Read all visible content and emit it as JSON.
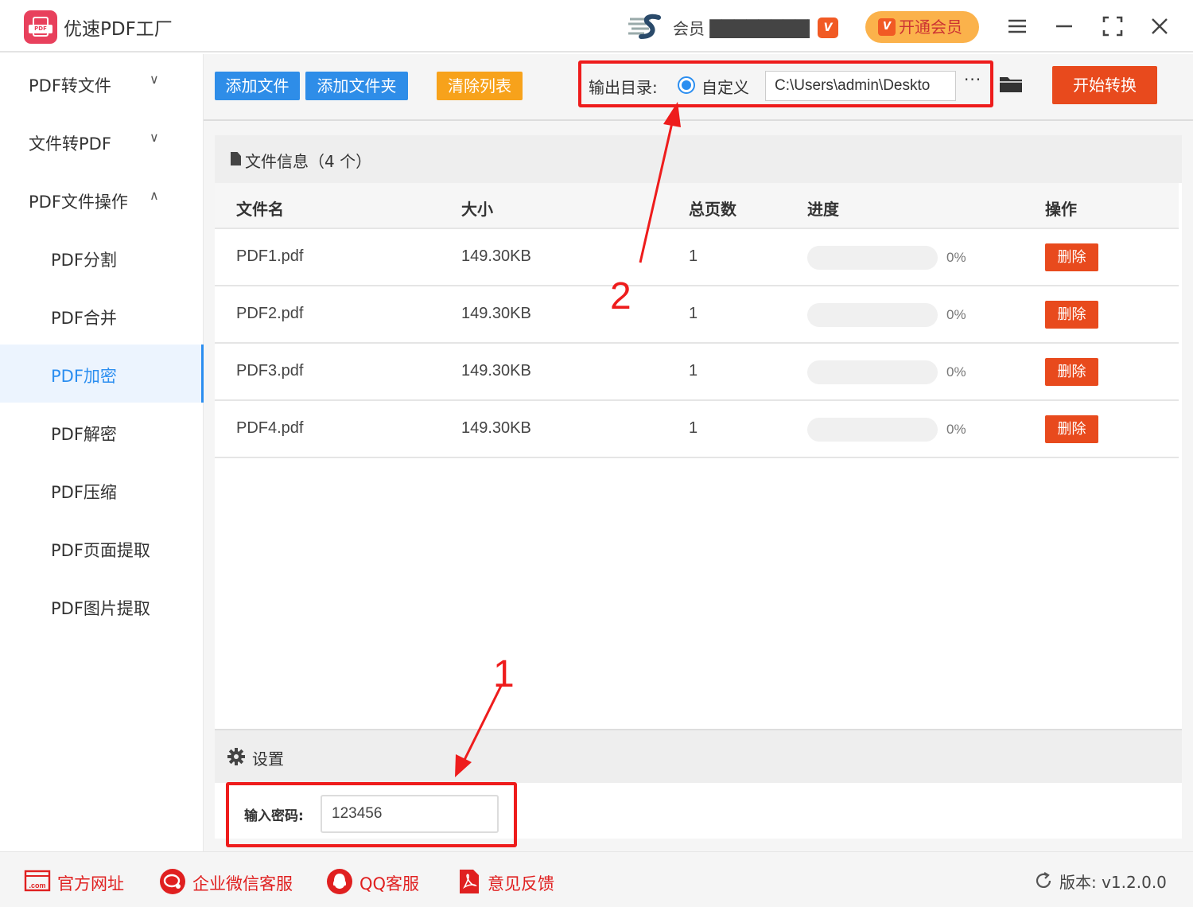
{
  "app": {
    "title": "优速PDF工厂",
    "logo_tag": "PDF"
  },
  "header": {
    "user_name": "会员 ████████████",
    "vip_badge": "V",
    "vip_button": "开通会员",
    "menu_icon": "menu-icon",
    "window_icons": [
      "minimize-icon",
      "fullscreen-icon",
      "close-icon"
    ]
  },
  "sidebar": {
    "items": [
      {
        "label": "PDF转文件",
        "chevron": "⌄"
      },
      {
        "label": "文件转PDF",
        "chevron": "⌄"
      },
      {
        "label": "PDF文件操作",
        "chevron": "⌃"
      },
      {
        "label": "PDF分割"
      },
      {
        "label": "PDF合并"
      },
      {
        "label": "PDF加密",
        "active": true
      },
      {
        "label": "PDF解密"
      },
      {
        "label": "PDF压缩"
      },
      {
        "label": "PDF页面提取"
      },
      {
        "label": "PDF图片提取"
      }
    ]
  },
  "toolbar": {
    "add_file": "添加文件",
    "add_folder": "添加文件夹",
    "clear_list": "清除列表",
    "output_label": "输出目录:",
    "radio_label": "自定义",
    "output_path": "C:\\Users\\admin\\Deskto",
    "browse": "···",
    "start": "开始转换"
  },
  "file_panel": {
    "title": "文件信息（4 个）",
    "columns": [
      "文件名",
      "大小",
      "总页数",
      "进度",
      "操作"
    ],
    "rows": [
      {
        "name": "PDF1.pdf",
        "size": "149.30KB",
        "pages": "1",
        "progress": 0,
        "progress_text": "0%",
        "action": "删除"
      },
      {
        "name": "PDF2.pdf",
        "size": "149.30KB",
        "pages": "1",
        "progress": 0,
        "progress_text": "0%",
        "action": "删除"
      },
      {
        "name": "PDF3.pdf",
        "size": "149.30KB",
        "pages": "1",
        "progress": 0,
        "progress_text": "0%",
        "action": "删除"
      },
      {
        "name": "PDF4.pdf",
        "size": "149.30KB",
        "pages": "1",
        "progress": 0,
        "progress_text": "0%",
        "action": "删除"
      }
    ]
  },
  "settings": {
    "title": "设置",
    "password_label": "输入密码:",
    "password_value": "123456"
  },
  "annotations": {
    "step1": "1",
    "step2": "2",
    "color": "#ee1c1c"
  },
  "footer": {
    "links": [
      "官方网址",
      "企业微信客服",
      "QQ客服",
      "意见反馈"
    ],
    "com_badge": ".com",
    "version": "版本: v1.2.0.0"
  },
  "colors": {
    "accent_blue": "#2b8ef0",
    "danger": "#e84a1d",
    "orange": "#f7a21b",
    "footer_red": "#e02020"
  }
}
